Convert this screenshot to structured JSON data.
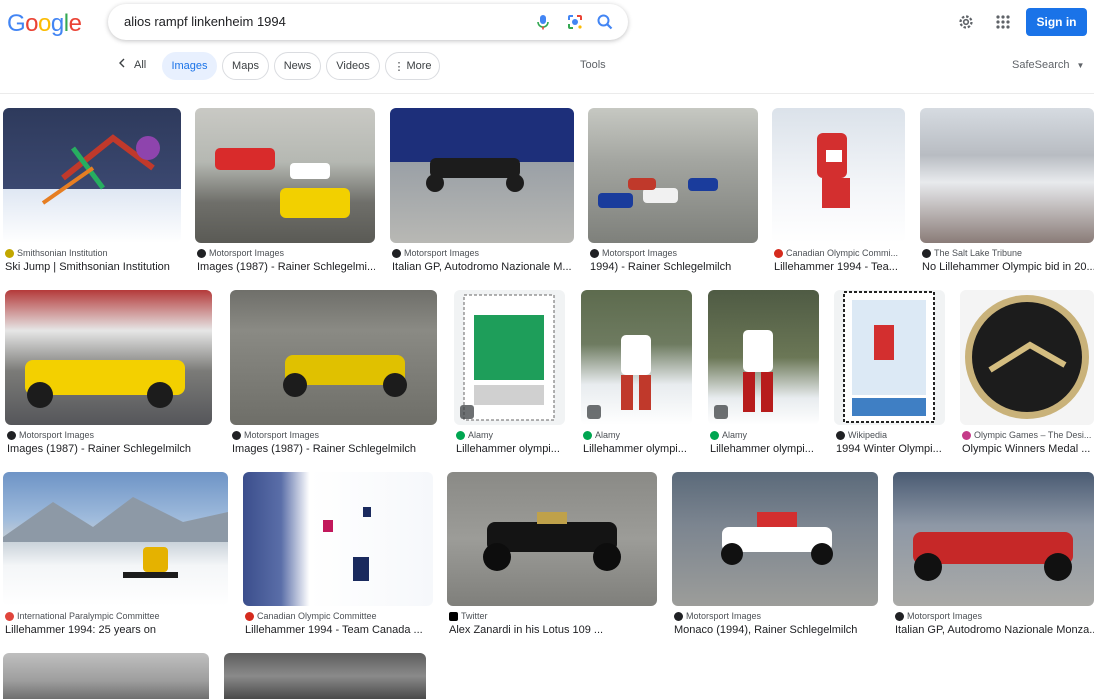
{
  "header": {
    "logo": [
      "G",
      "o",
      "o",
      "g",
      "l",
      "e"
    ],
    "logo_colors": [
      "#4285f4",
      "#ea4335",
      "#fbbc05",
      "#4285f4",
      "#34a853",
      "#ea4335"
    ],
    "query": "alios rampf linkenheim 1994",
    "signin_label": "Sign in"
  },
  "tabs": {
    "all": "All",
    "chips": [
      "Images",
      "Maps",
      "News",
      "Videos",
      "More"
    ],
    "tools": "Tools",
    "safesearch": "SafeSearch"
  },
  "results": [
    {
      "source": "Smithsonian Institution",
      "title": "Ski Jump | Smithsonian Institution",
      "favicon_color": "#c2a700"
    },
    {
      "source": "Motorsport Images",
      "title": "Images (1987) - Rainer Schlegelmi...",
      "favicon_color": "#202124"
    },
    {
      "source": "Motorsport Images",
      "title": "Italian GP, Autodromo Nazionale M...",
      "favicon_color": "#202124"
    },
    {
      "source": "Motorsport Images",
      "title": "1994) - Rainer Schlegelmilch",
      "favicon_color": "#202124"
    },
    {
      "source": "Canadian Olympic Commi...",
      "title": "Lillehammer 1994 - Tea...",
      "favicon_color": "#d52b1e"
    },
    {
      "source": "The Salt Lake Tribune",
      "title": "No Lillehammer Olympic bid in 20...",
      "favicon_color": "#202124"
    },
    {
      "source": "Motorsport Images",
      "title": "Images (1987) - Rainer Schlegelmilch",
      "favicon_color": "#202124"
    },
    {
      "source": "Motorsport Images",
      "title": "Images (1987) - Rainer Schlegelmilch",
      "favicon_color": "#202124"
    },
    {
      "source": "Alamy",
      "title": "Lillehammer olympi...",
      "favicon_color": "#00a651"
    },
    {
      "source": "Alamy",
      "title": "Lillehammer olympi...",
      "favicon_color": "#00a651"
    },
    {
      "source": "Alamy",
      "title": "Lillehammer olympi...",
      "favicon_color": "#00a651"
    },
    {
      "source": "Wikipedia",
      "title": "1994 Winter Olympi...",
      "favicon_color": "#202124"
    },
    {
      "source": "Olympic Games – The Desi...",
      "title": "Olympic Winners Medal ...",
      "favicon_color": "#c53b89"
    },
    {
      "source": "International Paralympic Committee",
      "title": "Lillehammer 1994: 25 years on",
      "favicon_color": "#e0453c"
    },
    {
      "source": "Canadian Olympic Committee",
      "title": "Lillehammer 1994 - Team Canada ...",
      "favicon_color": "#d52b1e"
    },
    {
      "source": "Twitter",
      "title": "Alex Zanardi in his Lotus 109 ...",
      "favicon_color": "#000000"
    },
    {
      "source": "Motorsport Images",
      "title": "Monaco (1994), Rainer Schlegelmilch",
      "favicon_color": "#202124"
    },
    {
      "source": "Motorsport Images",
      "title": "Italian GP, Autodromo Nazionale Monza...",
      "favicon_color": "#202124"
    }
  ]
}
